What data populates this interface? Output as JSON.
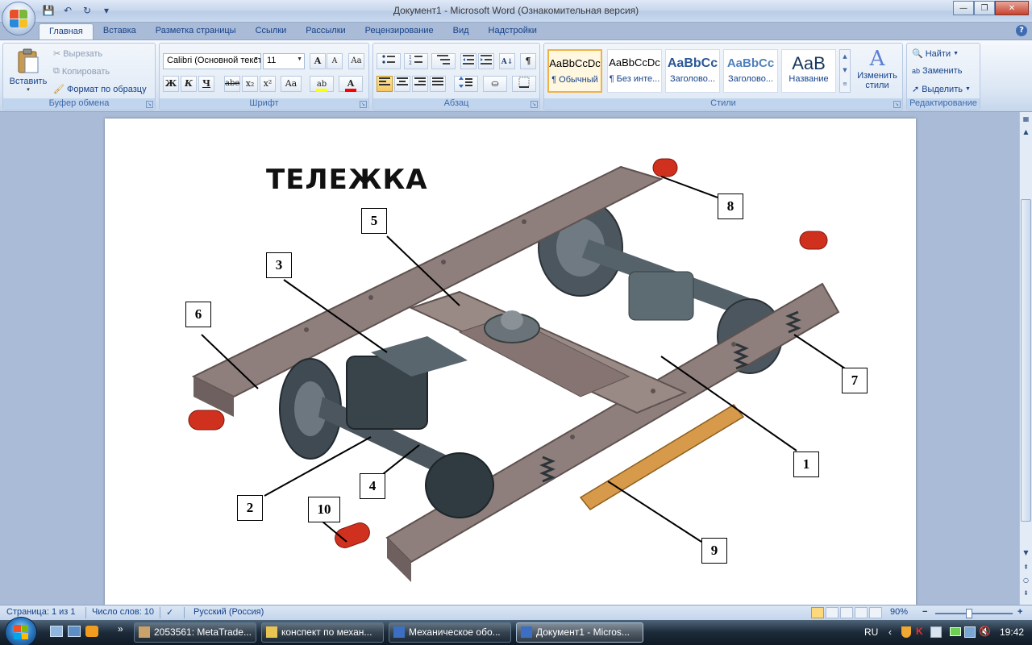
{
  "window": {
    "title": "Документ1 - Microsoft Word (Ознакомительная версия)",
    "controls": {
      "minimize": "—",
      "maximize": "❐",
      "close": "✕"
    }
  },
  "qat": {
    "save": "💾",
    "undo": "↶",
    "redo": "↻",
    "customize": "▾"
  },
  "tabs": [
    {
      "label": "Главная",
      "active": true
    },
    {
      "label": "Вставка"
    },
    {
      "label": "Разметка страницы"
    },
    {
      "label": "Ссылки"
    },
    {
      "label": "Рассылки"
    },
    {
      "label": "Рецензирование"
    },
    {
      "label": "Вид"
    },
    {
      "label": "Надстройки"
    }
  ],
  "help": "?",
  "ribbon": {
    "clipboard": {
      "label": "Буфер обмена",
      "paste": "Вставить",
      "cut": "Вырезать",
      "copy": "Копировать",
      "format_painter": "Формат по образцу"
    },
    "font": {
      "label": "Шрифт",
      "font_name": "Calibri (Основной текст)",
      "font_size": "11",
      "grow": "A",
      "shrink": "A",
      "clear": "Aa",
      "bold": "Ж",
      "italic": "К",
      "underline": "Ч",
      "strike": "abe",
      "subscript": "x₂",
      "superscript": "x²",
      "case": "Aa",
      "highlight_color": "#ffff00",
      "font_color": "#ff0000"
    },
    "paragraph": {
      "label": "Абзац",
      "pilcrow": "¶"
    },
    "styles": {
      "label": "Стили",
      "items": [
        {
          "sample": "AaBbCcDc",
          "name": "¶ Обычный",
          "selected": true
        },
        {
          "sample": "AaBbCcDc",
          "name": "¶ Без инте..."
        },
        {
          "sample": "AaBbCc",
          "name": "Заголово..."
        },
        {
          "sample": "AaBbCc",
          "name": "Заголово..."
        },
        {
          "sample": "AaB",
          "name": "Название"
        }
      ],
      "change_styles": "Изменить стили"
    },
    "editing": {
      "label": "Редактирование",
      "find": "Найти",
      "replace": "Заменить",
      "select": "Выделить"
    }
  },
  "document": {
    "figure_title": "ТЕЛЕЖКА",
    "callouts": [
      "8",
      "5",
      "3",
      "6",
      "7",
      "1",
      "2",
      "4",
      "10",
      "9"
    ]
  },
  "statusbar": {
    "page": "Страница: 1 из 1",
    "words": "Число слов: 10",
    "language": "Русский (Россия)",
    "zoom": "90%",
    "zoom_out": "−",
    "zoom_in": "+"
  },
  "taskbar": {
    "tasks": [
      {
        "label": "2053561: MetaTrade..."
      },
      {
        "label": "конспект по механ..."
      },
      {
        "label": "Механическое обо..."
      },
      {
        "label": "Документ1 - Micros...",
        "active": true
      }
    ],
    "overflow": "»",
    "lang": "RU",
    "clock": "19:42"
  },
  "colors": {
    "bogie_frame": "#8f7f7c",
    "axle_box_cap": "#d0301e",
    "wheel": "#3f4a52",
    "spring_rod": "#d79a4a"
  }
}
